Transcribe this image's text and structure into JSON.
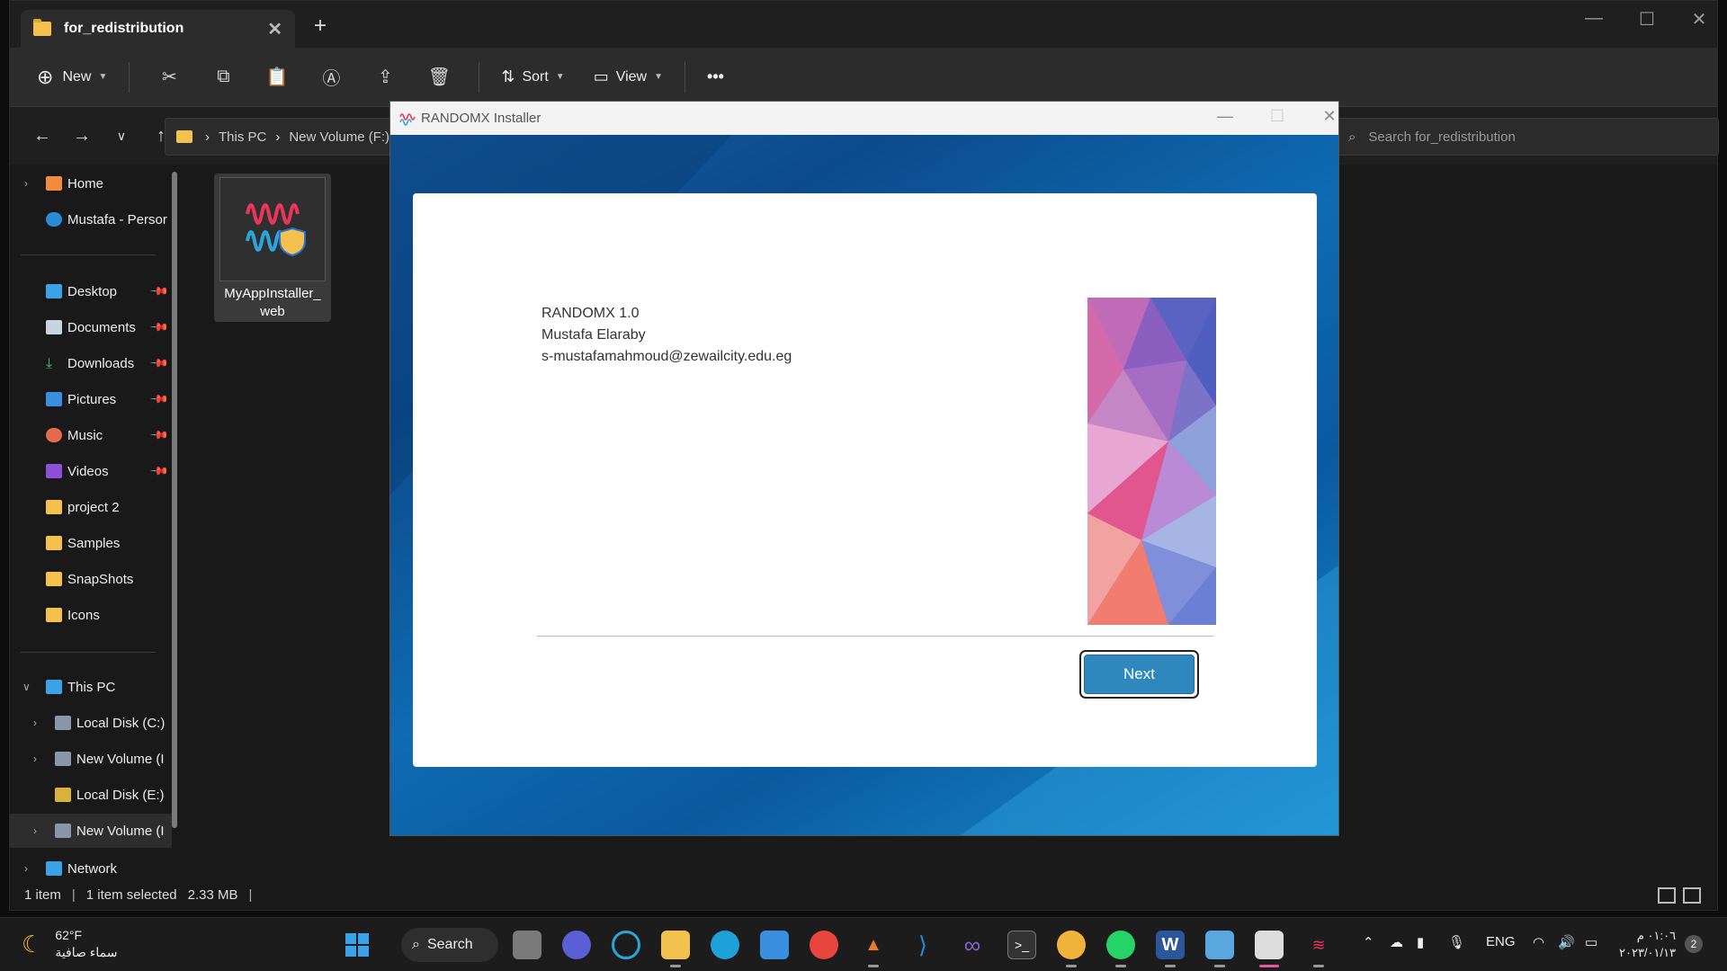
{
  "explorer": {
    "tab_title": "for_redistribution",
    "toolbar": {
      "new_label": "New",
      "sort_label": "Sort",
      "view_label": "View",
      "more_label": "•••"
    },
    "address": {
      "crumbs": [
        "This PC",
        "New Volume (F:)"
      ]
    },
    "search_placeholder": "Search for_redistribution",
    "sidebar": {
      "home": "Home",
      "onedrive": "Mustafa - Persor",
      "quick": [
        "Desktop",
        "Documents",
        "Downloads",
        "Pictures",
        "Music",
        "Videos"
      ],
      "folders": [
        "project 2",
        "Samples",
        "SnapShots",
        "Icons"
      ],
      "this_pc": "This PC",
      "drives": [
        "Local Disk (C:)",
        "New Volume (I",
        "Local Disk (E:)",
        "New Volume (I"
      ],
      "network": "Network"
    },
    "file": {
      "name_line1": "MyAppInstaller_",
      "name_line2": "web"
    },
    "status": {
      "count": "1 item",
      "selected": "1 item selected",
      "size": "2.33 MB"
    }
  },
  "installer": {
    "title": "RANDOMX Installer",
    "app_name": "RANDOMX 1.0",
    "author": "Mustafa Elaraby",
    "email": "s-mustafamahmoud@zewailcity.edu.eg",
    "next_label": "Next"
  },
  "taskbar": {
    "temperature": "62°F",
    "weather_desc": "سماء صافية",
    "search_label": "Search",
    "language": "ENG",
    "time": "٠١:٠٦ م",
    "date": "٢٠٢٣/٠١/١٣",
    "notification_count": "2"
  },
  "colors": {
    "accent": "#2f88bd",
    "folder": "#f2c14e",
    "installer_bg": "#0b4b8c"
  }
}
